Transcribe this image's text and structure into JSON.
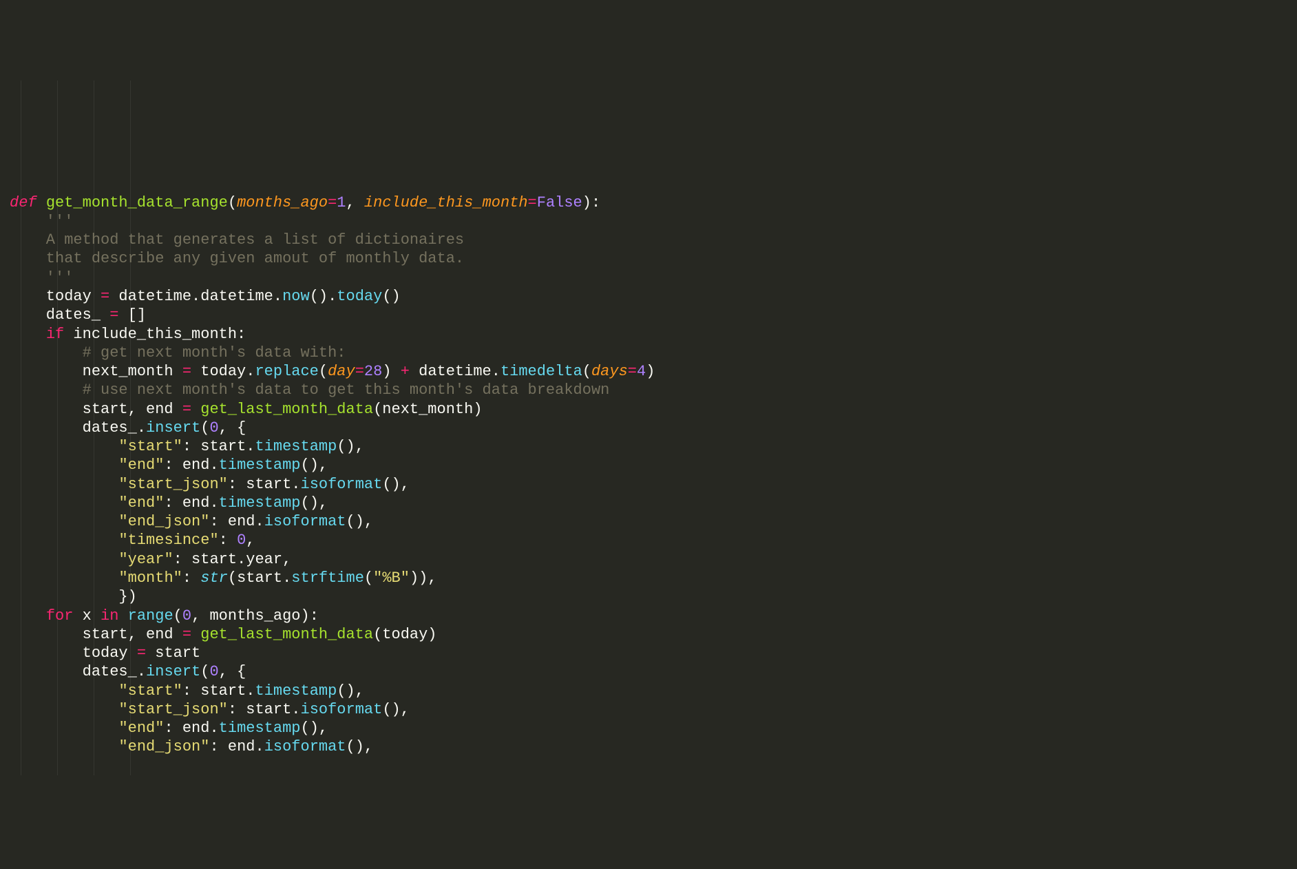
{
  "language": "python",
  "theme": "monokai",
  "colors": {
    "background": "#272822",
    "foreground": "#f8f8f2",
    "keyword": "#f92672",
    "function": "#a6e22e",
    "call": "#66d9ef",
    "param": "#fd971f",
    "number": "#ae81ff",
    "string": "#e6db74",
    "comment": "#75715e"
  },
  "code": {
    "lines": [
      {
        "n": 1,
        "tokens": [
          {
            "t": "def ",
            "c": "kw"
          },
          {
            "t": "get_month_data_range",
            "c": "fn"
          },
          {
            "t": "(",
            "c": "punct"
          },
          {
            "t": "months_ago",
            "c": "param"
          },
          {
            "t": "=",
            "c": "op"
          },
          {
            "t": "1",
            "c": "num"
          },
          {
            "t": ", ",
            "c": "punct"
          },
          {
            "t": "include_this_month",
            "c": "param"
          },
          {
            "t": "=",
            "c": "op"
          },
          {
            "t": "False",
            "c": "const"
          },
          {
            "t": "):",
            "c": "punct"
          }
        ]
      },
      {
        "n": 2,
        "tokens": [
          {
            "t": "    '''",
            "c": "cmt"
          }
        ]
      },
      {
        "n": 3,
        "tokens": [
          {
            "t": "    A method that generates a list of dictionaires",
            "c": "cmt"
          }
        ]
      },
      {
        "n": 4,
        "tokens": [
          {
            "t": "    that describe any given amout of monthly data.",
            "c": "cmt"
          }
        ]
      },
      {
        "n": 5,
        "tokens": [
          {
            "t": "    '''",
            "c": "cmt"
          }
        ]
      },
      {
        "n": 6,
        "tokens": [
          {
            "t": "    today ",
            "c": "ident"
          },
          {
            "t": "=",
            "c": "op"
          },
          {
            "t": " datetime.datetime.",
            "c": "ident"
          },
          {
            "t": "now",
            "c": "fncall"
          },
          {
            "t": "().",
            "c": "punct"
          },
          {
            "t": "today",
            "c": "fncall"
          },
          {
            "t": "()",
            "c": "punct"
          }
        ]
      },
      {
        "n": 7,
        "tokens": [
          {
            "t": "    dates_ ",
            "c": "ident"
          },
          {
            "t": "=",
            "c": "op"
          },
          {
            "t": " []",
            "c": "punct"
          }
        ]
      },
      {
        "n": 8,
        "tokens": [
          {
            "t": "    ",
            "c": "ident"
          },
          {
            "t": "if",
            "c": "kwplain"
          },
          {
            "t": " include_this_month:",
            "c": "ident"
          }
        ]
      },
      {
        "n": 9,
        "tokens": [
          {
            "t": "        # get next month's data with:",
            "c": "cmt"
          }
        ]
      },
      {
        "n": 10,
        "tokens": [
          {
            "t": "        next_month ",
            "c": "ident"
          },
          {
            "t": "=",
            "c": "op"
          },
          {
            "t": " today.",
            "c": "ident"
          },
          {
            "t": "replace",
            "c": "fncall"
          },
          {
            "t": "(",
            "c": "punct"
          },
          {
            "t": "day",
            "c": "param"
          },
          {
            "t": "=",
            "c": "op"
          },
          {
            "t": "28",
            "c": "num"
          },
          {
            "t": ") ",
            "c": "punct"
          },
          {
            "t": "+",
            "c": "op"
          },
          {
            "t": " datetime.",
            "c": "ident"
          },
          {
            "t": "timedelta",
            "c": "fncall"
          },
          {
            "t": "(",
            "c": "punct"
          },
          {
            "t": "days",
            "c": "param"
          },
          {
            "t": "=",
            "c": "op"
          },
          {
            "t": "4",
            "c": "num"
          },
          {
            "t": ")",
            "c": "punct"
          }
        ]
      },
      {
        "n": 11,
        "tokens": [
          {
            "t": "        # use next month's data to get this month's data breakdown",
            "c": "cmt"
          }
        ]
      },
      {
        "n": 12,
        "tokens": [
          {
            "t": "        start, end ",
            "c": "ident"
          },
          {
            "t": "=",
            "c": "op"
          },
          {
            "t": " ",
            "c": "ident"
          },
          {
            "t": "get_last_month_data",
            "c": "fncallg"
          },
          {
            "t": "(next_month)",
            "c": "punct"
          }
        ]
      },
      {
        "n": 13,
        "tokens": [
          {
            "t": "        dates_.",
            "c": "ident"
          },
          {
            "t": "insert",
            "c": "fncall"
          },
          {
            "t": "(",
            "c": "punct"
          },
          {
            "t": "0",
            "c": "num"
          },
          {
            "t": ", {",
            "c": "punct"
          }
        ]
      },
      {
        "n": 14,
        "tokens": [
          {
            "t": "            ",
            "c": "ident"
          },
          {
            "t": "\"start\"",
            "c": "str"
          },
          {
            "t": ": start.",
            "c": "ident"
          },
          {
            "t": "timestamp",
            "c": "fncall"
          },
          {
            "t": "(),",
            "c": "punct"
          }
        ]
      },
      {
        "n": 15,
        "tokens": [
          {
            "t": "            ",
            "c": "ident"
          },
          {
            "t": "\"end\"",
            "c": "str"
          },
          {
            "t": ": end.",
            "c": "ident"
          },
          {
            "t": "timestamp",
            "c": "fncall"
          },
          {
            "t": "(),",
            "c": "punct"
          }
        ]
      },
      {
        "n": 16,
        "tokens": [
          {
            "t": "            ",
            "c": "ident"
          },
          {
            "t": "\"start_json\"",
            "c": "str"
          },
          {
            "t": ": start.",
            "c": "ident"
          },
          {
            "t": "isoformat",
            "c": "fncall"
          },
          {
            "t": "(),",
            "c": "punct"
          }
        ]
      },
      {
        "n": 17,
        "tokens": [
          {
            "t": "            ",
            "c": "ident"
          },
          {
            "t": "\"end\"",
            "c": "str"
          },
          {
            "t": ": end.",
            "c": "ident"
          },
          {
            "t": "timestamp",
            "c": "fncall"
          },
          {
            "t": "(),",
            "c": "punct"
          }
        ]
      },
      {
        "n": 18,
        "tokens": [
          {
            "t": "            ",
            "c": "ident"
          },
          {
            "t": "\"end_json\"",
            "c": "str"
          },
          {
            "t": ": end.",
            "c": "ident"
          },
          {
            "t": "isoformat",
            "c": "fncall"
          },
          {
            "t": "(),",
            "c": "punct"
          }
        ]
      },
      {
        "n": 19,
        "tokens": [
          {
            "t": "            ",
            "c": "ident"
          },
          {
            "t": "\"timesince\"",
            "c": "str"
          },
          {
            "t": ": ",
            "c": "ident"
          },
          {
            "t": "0",
            "c": "num"
          },
          {
            "t": ",",
            "c": "punct"
          }
        ]
      },
      {
        "n": 20,
        "tokens": [
          {
            "t": "            ",
            "c": "ident"
          },
          {
            "t": "\"year\"",
            "c": "str"
          },
          {
            "t": ": start.year,",
            "c": "ident"
          }
        ]
      },
      {
        "n": 21,
        "tokens": [
          {
            "t": "            ",
            "c": "ident"
          },
          {
            "t": "\"month\"",
            "c": "str"
          },
          {
            "t": ": ",
            "c": "ident"
          },
          {
            "t": "str",
            "c": "builtin"
          },
          {
            "t": "(start.",
            "c": "ident"
          },
          {
            "t": "strftime",
            "c": "fncall"
          },
          {
            "t": "(",
            "c": "punct"
          },
          {
            "t": "\"%B\"",
            "c": "str"
          },
          {
            "t": ")),",
            "c": "punct"
          }
        ]
      },
      {
        "n": 22,
        "tokens": [
          {
            "t": "            })",
            "c": "punct"
          }
        ]
      },
      {
        "n": 23,
        "tokens": [
          {
            "t": "    ",
            "c": "ident"
          },
          {
            "t": "for",
            "c": "kwplain"
          },
          {
            "t": " x ",
            "c": "ident"
          },
          {
            "t": "in",
            "c": "kwplain"
          },
          {
            "t": " ",
            "c": "ident"
          },
          {
            "t": "range",
            "c": "fncall"
          },
          {
            "t": "(",
            "c": "punct"
          },
          {
            "t": "0",
            "c": "num"
          },
          {
            "t": ", months_ago):",
            "c": "ident"
          }
        ]
      },
      {
        "n": 24,
        "tokens": [
          {
            "t": "        start, end ",
            "c": "ident"
          },
          {
            "t": "=",
            "c": "op"
          },
          {
            "t": " ",
            "c": "ident"
          },
          {
            "t": "get_last_month_data",
            "c": "fncallg"
          },
          {
            "t": "(today)",
            "c": "punct"
          }
        ]
      },
      {
        "n": 25,
        "tokens": [
          {
            "t": "        today ",
            "c": "ident"
          },
          {
            "t": "=",
            "c": "op"
          },
          {
            "t": " start",
            "c": "ident"
          }
        ]
      },
      {
        "n": 26,
        "tokens": [
          {
            "t": "        dates_.",
            "c": "ident"
          },
          {
            "t": "insert",
            "c": "fncall"
          },
          {
            "t": "(",
            "c": "punct"
          },
          {
            "t": "0",
            "c": "num"
          },
          {
            "t": ", {",
            "c": "punct"
          }
        ]
      },
      {
        "n": 27,
        "tokens": [
          {
            "t": "            ",
            "c": "ident"
          },
          {
            "t": "\"start\"",
            "c": "str"
          },
          {
            "t": ": start.",
            "c": "ident"
          },
          {
            "t": "timestamp",
            "c": "fncall"
          },
          {
            "t": "(),",
            "c": "punct"
          }
        ]
      },
      {
        "n": 28,
        "tokens": [
          {
            "t": "            ",
            "c": "ident"
          },
          {
            "t": "\"start_json\"",
            "c": "str"
          },
          {
            "t": ": start.",
            "c": "ident"
          },
          {
            "t": "isoformat",
            "c": "fncall"
          },
          {
            "t": "(),",
            "c": "punct"
          }
        ]
      },
      {
        "n": 29,
        "tokens": [
          {
            "t": "            ",
            "c": "ident"
          },
          {
            "t": "\"end\"",
            "c": "str"
          },
          {
            "t": ": end.",
            "c": "ident"
          },
          {
            "t": "timestamp",
            "c": "fncall"
          },
          {
            "t": "(),",
            "c": "punct"
          }
        ]
      },
      {
        "n": 30,
        "tokens": [
          {
            "t": "            ",
            "c": "ident"
          },
          {
            "t": "\"end_json\"",
            "c": "str"
          },
          {
            "t": ": end.",
            "c": "ident"
          },
          {
            "t": "isoformat",
            "c": "fncall"
          },
          {
            "t": "(),",
            "c": "punct"
          }
        ]
      }
    ]
  }
}
